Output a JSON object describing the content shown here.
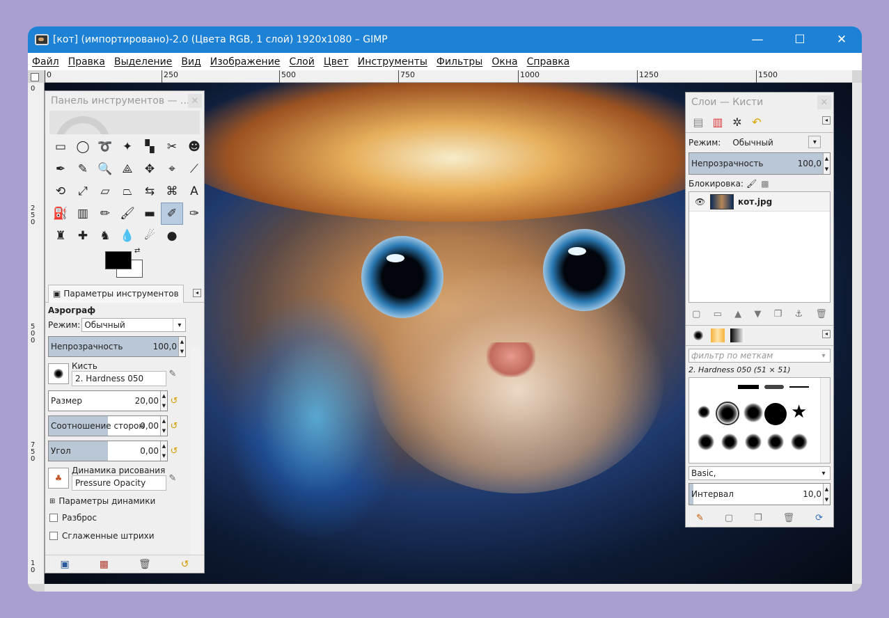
{
  "window": {
    "title": "[кот] (импортировано)-2.0 (Цвета RGB, 1 слой) 1920x1080 – GIMP",
    "minimize": "—",
    "maximize": "☐",
    "close": "✕"
  },
  "menu": [
    "Файл",
    "Правка",
    "Выделение",
    "Вид",
    "Изображение",
    "Слой",
    "Цвет",
    "Инструменты",
    "Фильтры",
    "Окна",
    "Справка"
  ],
  "ruler_top": [
    "0",
    "250",
    "500",
    "750",
    "1000",
    "1250",
    "1500"
  ],
  "ruler_left": [
    "0",
    "2\n5\n0",
    "5\n0\n0",
    "7\n5\n0",
    "1\n0"
  ],
  "toolbox": {
    "title": "Панель инструментов — ...",
    "close": "✕",
    "tools": [
      {
        "name": "rect-select-icon",
        "glyph": "▭"
      },
      {
        "name": "ellipse-select-icon",
        "glyph": "◯"
      },
      {
        "name": "free-select-icon",
        "glyph": "➰"
      },
      {
        "name": "fuzzy-select-icon",
        "glyph": "✦"
      },
      {
        "name": "color-select-icon",
        "glyph": "▚"
      },
      {
        "name": "scissors-icon",
        "glyph": "✂"
      },
      {
        "name": "foreground-select-icon",
        "glyph": "☻"
      },
      {
        "name": "paths-icon",
        "glyph": "✒"
      },
      {
        "name": "color-picker-icon",
        "glyph": "✎"
      },
      {
        "name": "zoom-icon",
        "glyph": "🔍"
      },
      {
        "name": "measure-icon",
        "glyph": "⟁"
      },
      {
        "name": "move-icon",
        "glyph": "✥"
      },
      {
        "name": "align-icon",
        "glyph": "⌖"
      },
      {
        "name": "crop-icon",
        "glyph": "⟋"
      },
      {
        "name": "rotate-icon",
        "glyph": "⟲"
      },
      {
        "name": "scale-icon",
        "glyph": "⤢"
      },
      {
        "name": "shear-icon",
        "glyph": "▱"
      },
      {
        "name": "perspective-icon",
        "glyph": "⏢"
      },
      {
        "name": "flip-icon",
        "glyph": "⇆"
      },
      {
        "name": "cage-icon",
        "glyph": "⌘"
      },
      {
        "name": "text-icon",
        "glyph": "A"
      },
      {
        "name": "bucket-fill-icon",
        "glyph": "⛽"
      },
      {
        "name": "blend-icon",
        "glyph": "▥"
      },
      {
        "name": "pencil-icon",
        "glyph": "✏"
      },
      {
        "name": "paintbrush-icon",
        "glyph": "🖌"
      },
      {
        "name": "eraser-icon",
        "glyph": "▬"
      },
      {
        "name": "airbrush-icon",
        "glyph": "✐"
      },
      {
        "name": "ink-icon",
        "glyph": "✑"
      },
      {
        "name": "clone-icon",
        "glyph": "♜"
      },
      {
        "name": "heal-icon",
        "glyph": "✚"
      },
      {
        "name": "perspective-clone-icon",
        "glyph": "♞"
      },
      {
        "name": "blur-icon",
        "glyph": "💧"
      },
      {
        "name": "smudge-icon",
        "glyph": "☄"
      },
      {
        "name": "dodge-burn-icon",
        "glyph": "●"
      }
    ],
    "colors": {
      "fg": "#000000",
      "bg": "#ffffff"
    }
  },
  "tool_options": {
    "tab": "Параметры инструментов",
    "tool_name": "Аэрограф",
    "mode_label": "Режим:",
    "mode_value": "Обычный",
    "opacity_label": "Непрозрачность",
    "opacity_value": "100,0",
    "opacity_level": 1.0,
    "brush_label": "Кисть",
    "brush_value": "2. Hardness 050",
    "size_label": "Размер",
    "size_value": "20,00",
    "size_level": 0.0,
    "aspect_label": "Соотношение сторон",
    "aspect_value": "0,00",
    "aspect_level": 0.5,
    "angle_label": "Угол",
    "angle_value": "0,00",
    "angle_level": 0.5,
    "dynamics_label": "Динамика рисования",
    "dynamics_value": "Pressure Opacity",
    "dynamics_params": "Параметры динамики",
    "scatter": "Разброс",
    "smooth": "Сглаженные штрихи"
  },
  "layers": {
    "title": "Слои — Кисти",
    "close": "✕",
    "mode_label": "Режим:",
    "mode_value": "Обычный",
    "opacity_label": "Непрозрачность",
    "opacity_value": "100,0",
    "opacity_level": 1.0,
    "lock_label": "Блокировка:",
    "layer_name": "кот.jpg"
  },
  "brushes": {
    "filter_placeholder": "фильтр по меткам",
    "selected_brush": "2. Hardness 050 (51 × 51)",
    "preset": "Basic,",
    "spacing_label": "Интервал",
    "spacing_value": "10,0",
    "spacing_level": 0.03
  }
}
